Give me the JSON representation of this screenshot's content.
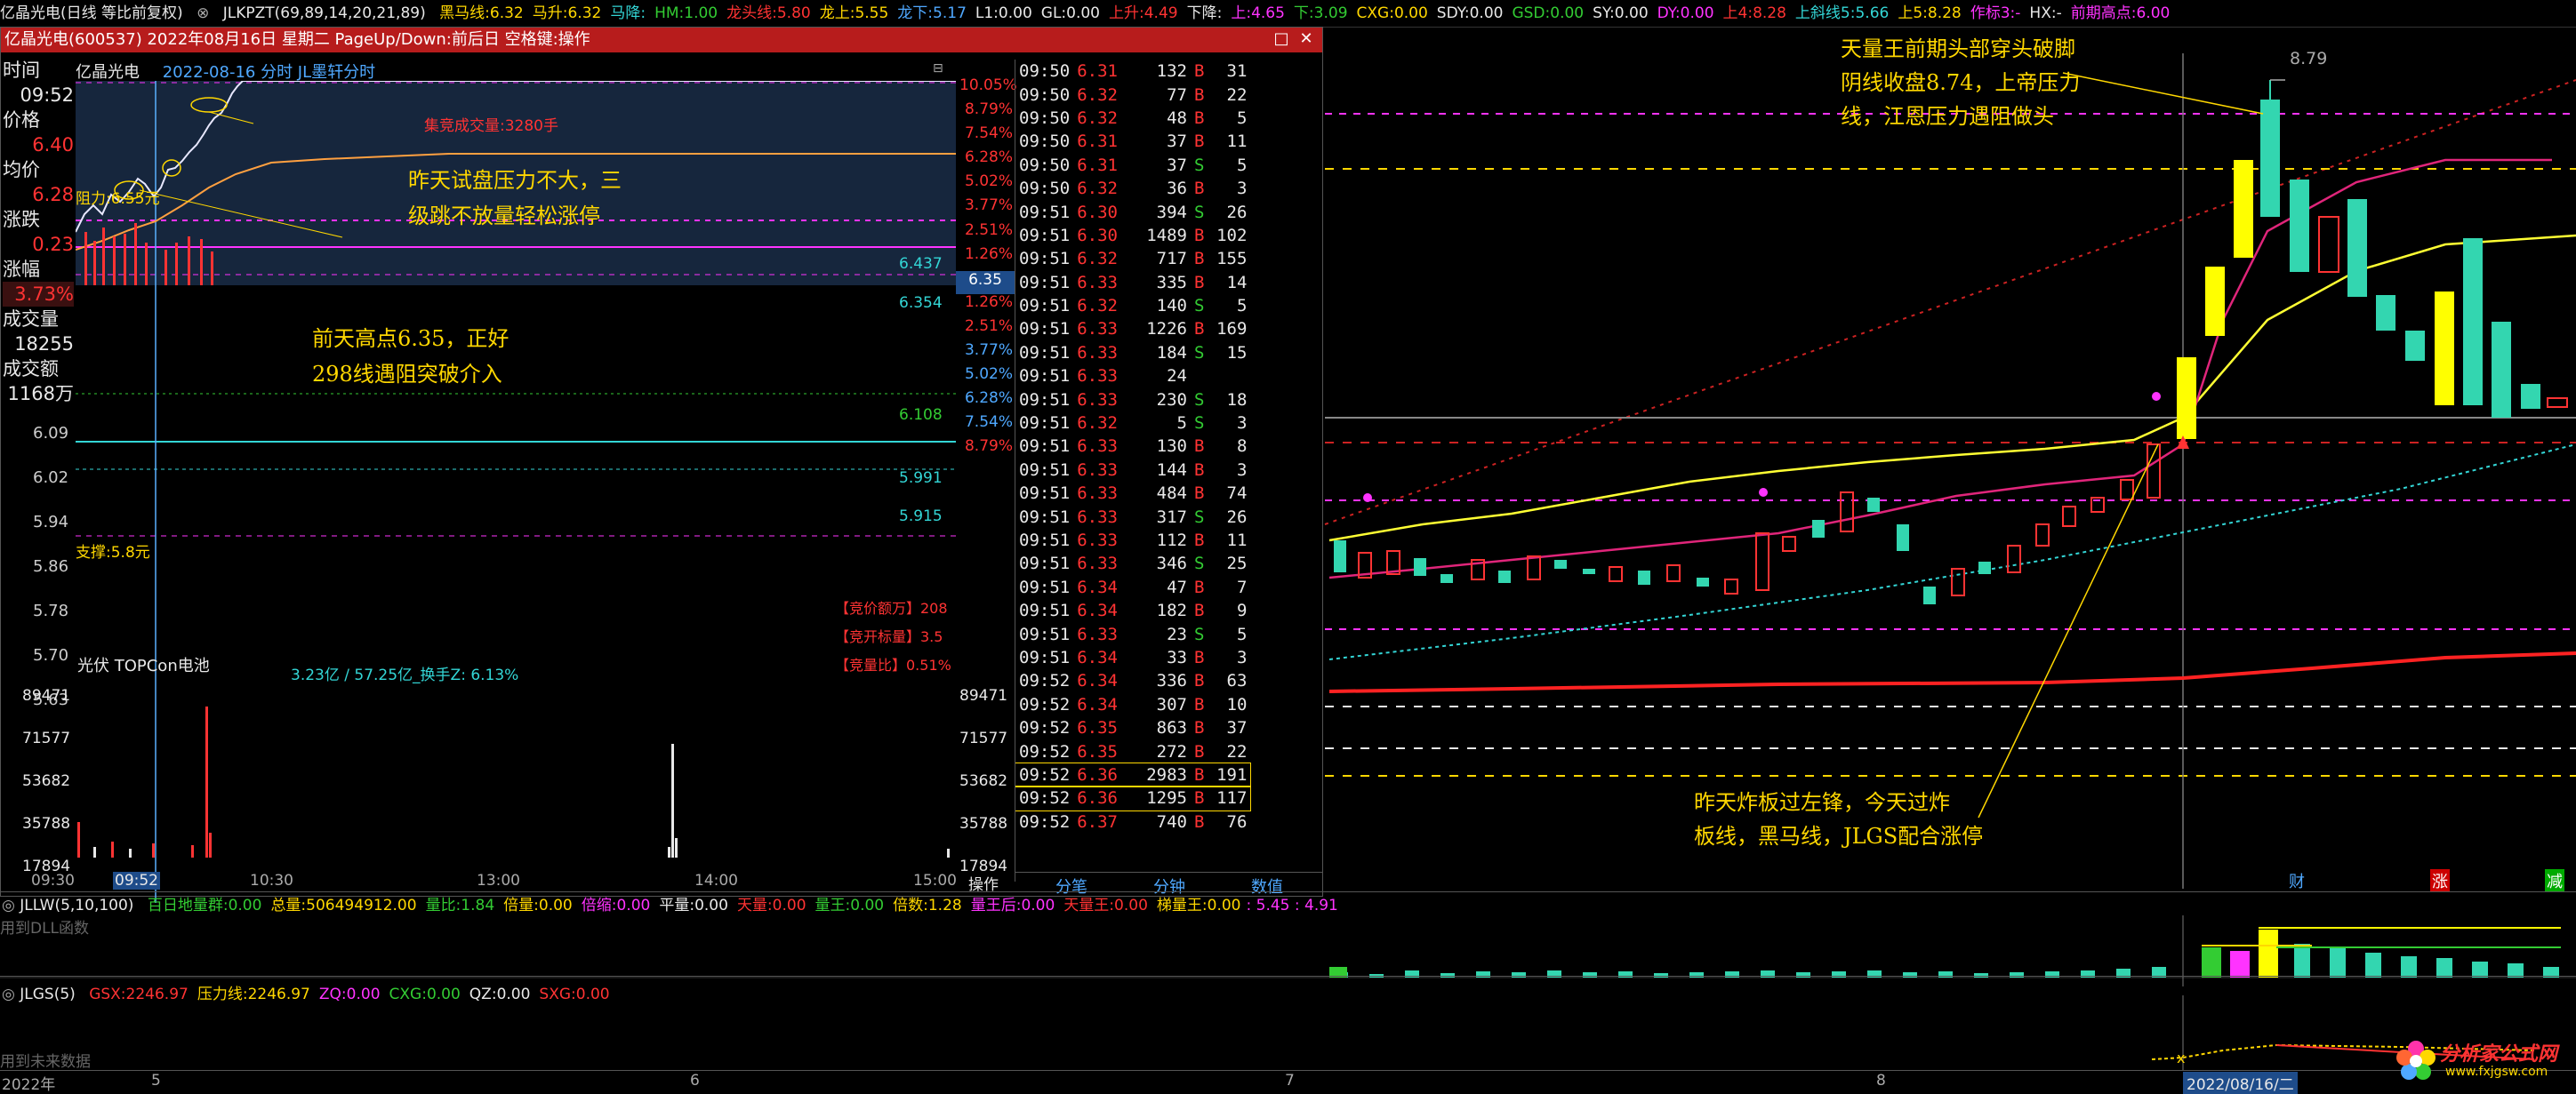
{
  "topbar": {
    "stock": "亿晶光电(日线 等比前复权)",
    "indicator": "JLKPZT(69,89,14,20,21,89)",
    "items": [
      {
        "label": "黑马线:",
        "value": "6.32",
        "color": "#ffd700"
      },
      {
        "label": "马升:",
        "value": "6.32",
        "color": "#ffd700"
      },
      {
        "label": "马降:",
        "value": "",
        "color": "#33d6d6"
      },
      {
        "label": "HM:",
        "value": "1.00",
        "color": "#33cc33"
      },
      {
        "label": "龙头线:",
        "value": "5.80",
        "color": "#ff3333"
      },
      {
        "label": "龙上:",
        "value": "5.55",
        "color": "#ffd700"
      },
      {
        "label": "龙下:",
        "value": "5.17",
        "color": "#4fa8ff"
      },
      {
        "label": "L1:",
        "value": "0.00",
        "color": "#e8e8e8"
      },
      {
        "label": "GL:",
        "value": "0.00",
        "color": "#e8e8e8"
      },
      {
        "label": "上升:",
        "value": "4.49",
        "color": "#ff3333"
      },
      {
        "label": "下降:",
        "value": "",
        "color": "#e8e8e8"
      },
      {
        "label": "上:",
        "value": "4.65",
        "color": "#ff33ff"
      },
      {
        "label": "下:",
        "value": "3.09",
        "color": "#33cc33"
      },
      {
        "label": "CXG:",
        "value": "0.00",
        "color": "#ffd700"
      },
      {
        "label": "SDY:",
        "value": "0.00",
        "color": "#e8e8e8"
      },
      {
        "label": "GSD:",
        "value": "0.00",
        "color": "#33cc33"
      },
      {
        "label": "SY:",
        "value": "0.00",
        "color": "#e8e8e8"
      },
      {
        "label": "DY:",
        "value": "0.00",
        "color": "#ff33ff"
      },
      {
        "label": "上4:",
        "value": "8.28",
        "color": "#ff3333"
      },
      {
        "label": "上斜线5:",
        "value": "5.66",
        "color": "#33d6d6"
      },
      {
        "label": "上5:",
        "value": "8.28",
        "color": "#ffd700"
      },
      {
        "label": "作标3:",
        "value": "-",
        "color": "#ff33ff"
      },
      {
        "label": "HX:",
        "value": "-",
        "color": "#e8e8e8"
      },
      {
        "label": "前期高点:",
        "value": "6.00",
        "color": "#ff33ff"
      }
    ]
  },
  "window": {
    "title": "亿晶光电(600537) 2022年08月16日 星期二 PageUp/Down:前后日 空格键:操作",
    "chart_header": "亿晶光电",
    "chart_date": "2022-08-16 分时 JL墨轩分时",
    "info": {
      "time_label": "时间",
      "time": "09:52",
      "price_label": "价格",
      "price": "6.40",
      "avg_label": "均价",
      "avg": "6.28",
      "change_label": "涨跌",
      "change": "0.23",
      "pct_label": "涨幅",
      "pct": "3.73%",
      "vol_label": "成交量",
      "vol": "18255",
      "amt_label": "成交额",
      "amt": "1168万"
    },
    "resistance": "阻力:6.55元",
    "support": "支撑:5.8元",
    "red_label": "集竞成交量:3280手",
    "price_axis": [
      "6.09",
      "6.02",
      "5.94",
      "5.86",
      "5.78",
      "5.70",
      "5.63"
    ],
    "pct_axis": [
      "10.05%",
      "8.79%",
      "7.54%",
      "6.28%",
      "5.02%",
      "3.77%",
      "2.51%",
      "1.26%",
      "0.00%",
      "1.26%",
      "2.51%",
      "3.77%",
      "5.02%",
      "6.28%",
      "7.54%",
      "8.79%"
    ],
    "level_labels": [
      "6.437",
      "6.354",
      "6.108",
      "5.991",
      "5.915"
    ],
    "right_red": [
      "【竞价额万】208",
      "【竞开标量】3.5",
      "【竞量比】0.51%"
    ],
    "sector": "光伏 TOPCon电池",
    "turnover": "3.23亿 / 57.25亿_换手Z: 6.13%",
    "vol_axis": [
      "89471",
      "71577",
      "53682",
      "35788",
      "17894"
    ],
    "time_axis": [
      "09:30",
      "09:52",
      "10:30",
      "13:00",
      "14:00",
      "15:00"
    ],
    "operate": "操作",
    "current_price_tag": "6.35",
    "tabs": [
      "分笔",
      "分钟",
      "数值"
    ]
  },
  "trades": [
    [
      "09:50",
      "6.31",
      "132",
      "B",
      "31"
    ],
    [
      "09:50",
      "6.32",
      "77",
      "B",
      "22"
    ],
    [
      "09:50",
      "6.32",
      "48",
      "B",
      "5"
    ],
    [
      "09:50",
      "6.31",
      "37",
      "B",
      "11"
    ],
    [
      "09:50",
      "6.31",
      "37",
      "S",
      "5"
    ],
    [
      "09:50",
      "6.32",
      "36",
      "B",
      "3"
    ],
    [
      "09:51",
      "6.30",
      "394",
      "S",
      "26"
    ],
    [
      "09:51",
      "6.30",
      "1489",
      "B",
      "102"
    ],
    [
      "09:51",
      "6.32",
      "717",
      "B",
      "155"
    ],
    [
      "09:51",
      "6.33",
      "335",
      "B",
      "14"
    ],
    [
      "09:51",
      "6.32",
      "140",
      "S",
      "5"
    ],
    [
      "09:51",
      "6.33",
      "1226",
      "B",
      "169"
    ],
    [
      "09:51",
      "6.33",
      "184",
      "S",
      "15"
    ],
    [
      "09:51",
      "6.33",
      "24",
      "",
      ""
    ],
    [
      "09:51",
      "6.33",
      "230",
      "S",
      "18"
    ],
    [
      "09:51",
      "6.32",
      "5",
      "S",
      "3"
    ],
    [
      "09:51",
      "6.33",
      "130",
      "B",
      "8"
    ],
    [
      "09:51",
      "6.33",
      "144",
      "B",
      "3"
    ],
    [
      "09:51",
      "6.33",
      "484",
      "B",
      "74"
    ],
    [
      "09:51",
      "6.33",
      "317",
      "S",
      "26"
    ],
    [
      "09:51",
      "6.33",
      "112",
      "B",
      "11"
    ],
    [
      "09:51",
      "6.33",
      "346",
      "S",
      "25"
    ],
    [
      "09:51",
      "6.34",
      "47",
      "B",
      "7"
    ],
    [
      "09:51",
      "6.34",
      "182",
      "B",
      "9"
    ],
    [
      "09:51",
      "6.33",
      "23",
      "S",
      "5"
    ],
    [
      "09:51",
      "6.34",
      "33",
      "B",
      "3"
    ],
    [
      "09:52",
      "6.34",
      "336",
      "B",
      "63"
    ],
    [
      "09:52",
      "6.34",
      "307",
      "B",
      "10"
    ],
    [
      "09:52",
      "6.35",
      "863",
      "B",
      "37"
    ],
    [
      "09:52",
      "6.35",
      "272",
      "B",
      "22"
    ],
    [
      "09:52",
      "6.36",
      "2983",
      "B",
      "191"
    ],
    [
      "09:52",
      "6.36",
      "1295",
      "B",
      "117"
    ],
    [
      "09:52",
      "6.37",
      "740",
      "B",
      "76"
    ]
  ],
  "annotations": {
    "a1": "昨天试盘压力不大，三\n级跳不放量轻松涨停",
    "a2": "前天高点6.35，正好\n298线遇阻突破介入",
    "a3": "天量王前期头部穿头破脚\n阴线收盘8.74，上帝压力\n线，江恩压力遇阻做头",
    "a4": "昨天炸板过左锋，今天过炸\n板线，黑马线，JLGS配合涨停"
  },
  "kline": {
    "peak_label": "8.79",
    "markers": [
      "财",
      "涨",
      "减"
    ],
    "date_tag": "2022/08/16/二"
  },
  "bottom": {
    "jllw": "JLLW(5,10,100)",
    "jllw_items": [
      {
        "label": "百日地量群:",
        "value": "0.00",
        "color": "#33cc33"
      },
      {
        "label": "总量:",
        "value": "506494912.00",
        "color": "#ffd700"
      },
      {
        "label": "量比:",
        "value": "1.84",
        "color": "#33cc33"
      },
      {
        "label": "倍量:",
        "value": "0.00",
        "color": "#ffd700"
      },
      {
        "label": "倍缩:",
        "value": "0.00",
        "color": "#ff33ff"
      },
      {
        "label": "平量:",
        "value": "0.00",
        "color": "#e8e8e8"
      },
      {
        "label": "天量:",
        "value": "0.00",
        "color": "#ff3333"
      },
      {
        "label": "量王:",
        "value": "0.00",
        "color": "#33cc33"
      },
      {
        "label": "倍数:",
        "value": "1.28",
        "color": "#ffd700"
      },
      {
        "label": "量王后:",
        "value": "0.00",
        "color": "#ff33ff"
      },
      {
        "label": "天量王:",
        "value": "0.00",
        "color": "#ff3333"
      },
      {
        "label": "梯量王:",
        "value": "0.00",
        "color": "#ffd700"
      }
    ],
    "jllw_tail": ": 5.45 : 4.91",
    "jlgs": "JLGS(5)",
    "jlgs_items": [
      {
        "label": "GSX:",
        "value": "2246.97",
        "color": "#ff3333"
      },
      {
        "label": "压力线:",
        "value": "2246.97",
        "color": "#ffd700"
      },
      {
        "label": "ZQ:",
        "value": "0.00",
        "color": "#ff33ff"
      },
      {
        "label": "CXG:",
        "value": "0.00",
        "color": "#33cc33"
      },
      {
        "label": "QZ:",
        "value": "0.00",
        "color": "#e8e8e8"
      },
      {
        "label": "SXG:",
        "value": "0.00",
        "color": "#ff3333"
      }
    ],
    "dll": "用到DLL函数",
    "future": "用到未来数据",
    "axis": [
      "2022年",
      "5",
      "6",
      "7",
      "8"
    ],
    "logo": "分析家公式网",
    "logo_url": "www.fxjgsw.com"
  }
}
